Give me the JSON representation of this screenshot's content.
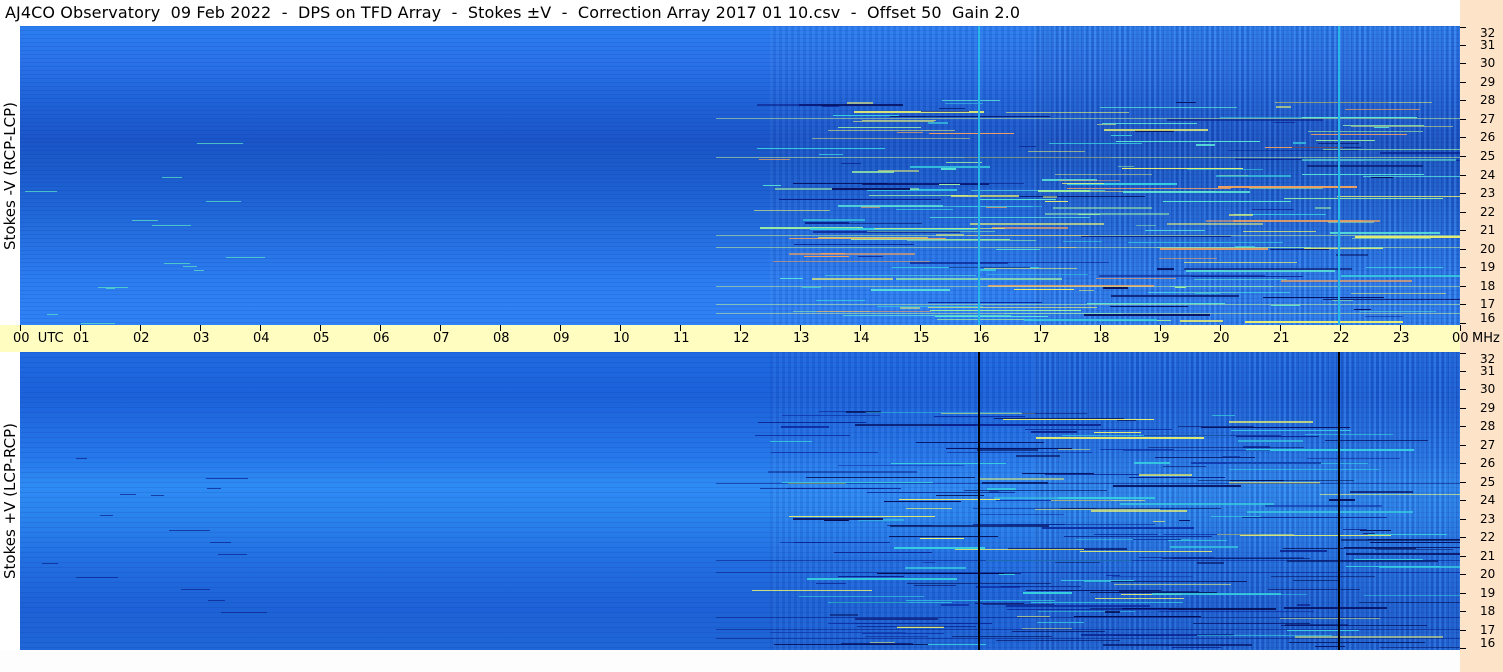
{
  "title": "AJ4CO Observatory  09 Feb 2022  -  DPS on TFD Array  -  Stokes ±V  -  Correction Array 2017 01 10.csv  -  Offset 50  Gain 2.0",
  "panels": {
    "top": {
      "ylabel": "Stokes -V (RCP-LCP)"
    },
    "bottom": {
      "ylabel": "Stokes +V (LCP-RCP)"
    }
  },
  "time_axis": {
    "labels": [
      "00  UTC",
      "01",
      "02",
      "03",
      "04",
      "05",
      "06",
      "07",
      "08",
      "09",
      "10",
      "11",
      "12",
      "13",
      "14",
      "15",
      "16",
      "17",
      "18",
      "19",
      "20",
      "21",
      "22",
      "23",
      "00"
    ],
    "unit": "MHz"
  },
  "frequency_axis": {
    "labels": [
      "32",
      "31",
      "30",
      "29",
      "28",
      "27",
      "26",
      "25",
      "24",
      "23",
      "22",
      "21",
      "20",
      "19",
      "18",
      "17",
      "16"
    ]
  },
  "colors": {
    "background_blue": "#1f66dc",
    "time_axis_bg": "#fffdc0",
    "freq_axis_bg": "#fde3c8",
    "top_marker_line": "#25b8e8",
    "bottom_marker_line": "#000000",
    "emission_yellow": "#e8f070",
    "emission_cyan": "#38d0e0",
    "dark_band": "#0a1f8a"
  },
  "markers": {
    "hours": [
      16,
      22
    ]
  }
}
